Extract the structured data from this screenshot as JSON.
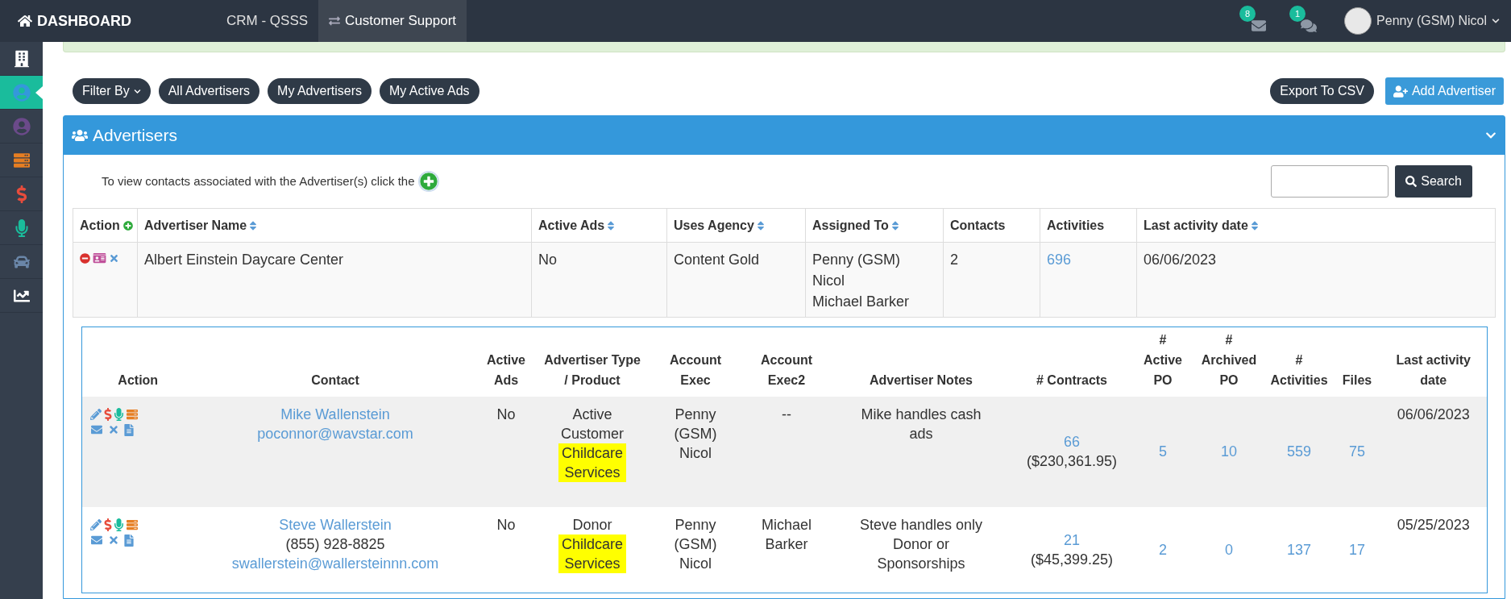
{
  "topbar": {
    "brand": "DASHBOARD",
    "nav": [
      {
        "label": "CRM - QSSS",
        "selected": false
      },
      {
        "label": "Customer Support",
        "selected": true
      }
    ],
    "mail_count": "8",
    "chat_count": "1",
    "user": "Penny (GSM) Nicol"
  },
  "sidebar": [
    {
      "kind": "building",
      "selected": false
    },
    {
      "kind": "user",
      "selected": true
    },
    {
      "kind": "contact",
      "selected": false
    },
    {
      "kind": "list",
      "selected": false
    },
    {
      "kind": "dollar",
      "selected": false
    },
    {
      "kind": "mic",
      "selected": false
    },
    {
      "kind": "car",
      "selected": false
    },
    {
      "kind": "chart",
      "selected": false
    }
  ],
  "toolbar": {
    "filter": "Filter By",
    "filters": [
      "All Advertisers",
      "My Advertisers",
      "My Active Ads"
    ],
    "export": "Export To CSV",
    "add": "Add Advertiser"
  },
  "panel": {
    "title": "Advertisers",
    "hint": "To view contacts associated with the Advertiser(s) click the",
    "search_button": "Search",
    "columns": [
      {
        "label": "Action",
        "sortable": false
      },
      {
        "label": "Advertiser Name",
        "sortable": true
      },
      {
        "label": "Active Ads",
        "sortable": true
      },
      {
        "label": "Uses Agency",
        "sortable": true
      },
      {
        "label": "Assigned To",
        "sortable": true
      },
      {
        "label": "Contacts",
        "sortable": false
      },
      {
        "label": "Activities",
        "sortable": false
      },
      {
        "label": "Last activity date",
        "sortable": true
      }
    ],
    "rows": [
      {
        "name": "Albert Einstein Daycare Center",
        "active_ads": "No",
        "agency": "Content Gold",
        "assigned_to": [
          "Penny (GSM) Nicol",
          "Michael Barker"
        ],
        "contacts": "2",
        "activities": "696",
        "last_activity": "06/06/2023",
        "contacts_table": {
          "columns": [
            [
              "Action"
            ],
            [
              "Contact"
            ],
            [
              "Active",
              "Ads"
            ],
            [
              "Advertiser Type",
              "/ Product"
            ],
            [
              "Account",
              "Exec"
            ],
            [
              "Account",
              "Exec2"
            ],
            [
              "Advertiser Notes"
            ],
            [
              "# Contracts"
            ],
            [
              "#",
              "Active",
              "PO"
            ],
            [
              "#",
              "Archived",
              "PO"
            ],
            [
              "#",
              "Activities"
            ],
            [
              "Files"
            ],
            [
              "Last activity",
              "date"
            ]
          ],
          "rows": [
            {
              "name": "Mike Wallenstein",
              "email": "poconnor@wavstar.com",
              "active_ads": "No",
              "type": "Active Customer",
              "product": "Childcare Services",
              "product_highlighted": true,
              "account_exec": "Penny (GSM) Nicol",
              "account_exec2": "--",
              "notes": "Mike handles cash ads",
              "contracts": "66",
              "contracts_amount": "($230,361.95)",
              "active_po": "5",
              "archived_po": "10",
              "activities": "559",
              "files": "75",
              "last_activity": "06/06/2023"
            },
            {
              "name": "Steve Wallerstein",
              "phone": "(855) 928-8825",
              "email": "swallerstein@wallersteinnn.com",
              "active_ads": "No",
              "type": "Donor",
              "product": "Childcare Services",
              "product_highlighted": true,
              "account_exec": "Penny (GSM) Nicol",
              "account_exec2": "Michael Barker",
              "notes": "Steve handles only Donor or Sponsorships",
              "contracts": "21",
              "contracts_amount": "($45,399.25)",
              "active_po": "2",
              "archived_po": "0",
              "activities": "137",
              "files": "17",
              "last_activity": "05/25/2023"
            }
          ]
        }
      }
    ]
  }
}
